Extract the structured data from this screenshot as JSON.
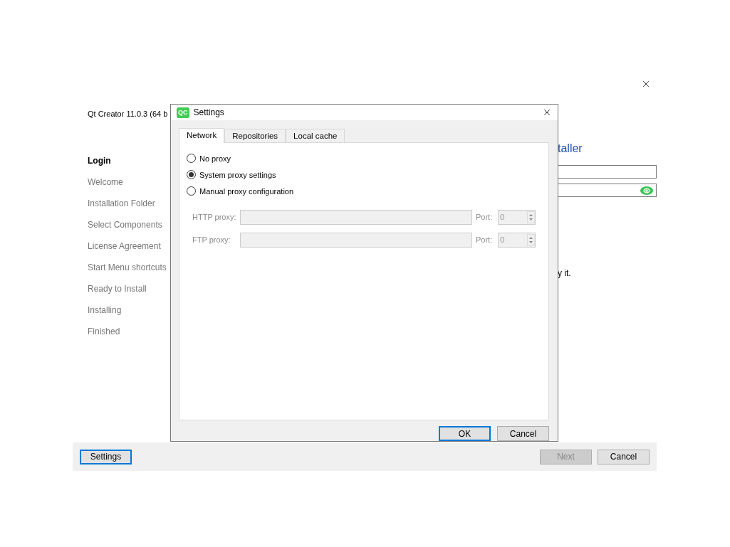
{
  "installer": {
    "title": "Qt Creator 11.0.3 (64 b",
    "heading": "taller",
    "steps": [
      {
        "label": "Login",
        "selected": true
      },
      {
        "label": "Welcome",
        "selected": false
      },
      {
        "label": "Installation Folder",
        "selected": false
      },
      {
        "label": "Select Components",
        "selected": false
      },
      {
        "label": "License Agreement",
        "selected": false
      },
      {
        "label": "Start Menu shortcuts",
        "selected": false
      },
      {
        "label": "Ready to Install",
        "selected": false
      },
      {
        "label": "Installing",
        "selected": false
      },
      {
        "label": "Finished",
        "selected": false
      }
    ],
    "fields": [
      {
        "kind": "text"
      },
      {
        "kind": "password"
      }
    ],
    "note": "y it.",
    "buttons": [
      {
        "label": "Settings",
        "focused": true,
        "disabled": false
      },
      {
        "label": "Next",
        "focused": false,
        "disabled": true
      },
      {
        "label": "Cancel",
        "focused": false,
        "disabled": false
      }
    ]
  },
  "dialog": {
    "logo": "QC",
    "title": "Settings",
    "tabs": [
      {
        "label": "Network",
        "selected": true
      },
      {
        "label": "Repositories",
        "selected": false
      },
      {
        "label": "Local cache",
        "selected": false
      }
    ],
    "proxy_options": [
      {
        "label": "No proxy",
        "selected": false
      },
      {
        "label": "System proxy settings",
        "selected": true
      },
      {
        "label": "Manual proxy configuration",
        "selected": false
      }
    ],
    "proxies": [
      {
        "label": "HTTP proxy:",
        "port_label": "Port:",
        "port": "0",
        "disabled": true
      },
      {
        "label": "FTP proxy:",
        "port_label": "Port:",
        "port": "0",
        "disabled": true
      }
    ],
    "buttons": [
      {
        "label": "OK",
        "focused": true
      },
      {
        "label": "Cancel",
        "focused": false
      }
    ]
  }
}
